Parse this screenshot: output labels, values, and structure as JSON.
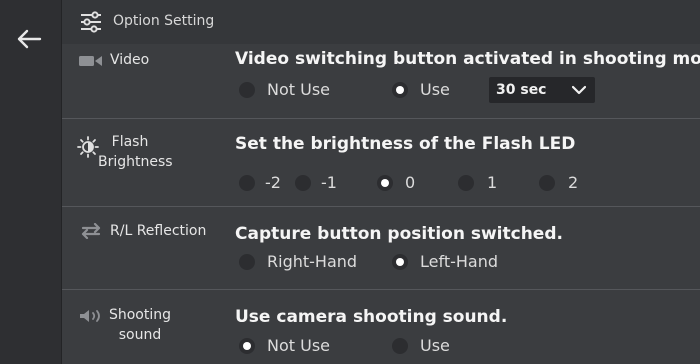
{
  "header": {
    "title": "Option Setting"
  },
  "sections": {
    "video": {
      "label": "Video",
      "description": "Video switching button activated in shooting mode.",
      "options": [
        "Not Use",
        "Use"
      ],
      "selected": "Use",
      "duration": "30 sec"
    },
    "flash": {
      "label_line1": "Flash",
      "label_line2": "Brightness",
      "description": "Set the brightness of the Flash LED",
      "options": [
        "-2",
        "-1",
        "0",
        "1",
        "2"
      ],
      "selected": "0"
    },
    "reflection": {
      "label": "R/L Reflection",
      "description": "Capture button position switched.",
      "options": [
        "Right-Hand",
        "Left-Hand"
      ],
      "selected": "Left-Hand"
    },
    "sound": {
      "label_line1": "Shooting",
      "label_line2": "sound",
      "description": "Use camera shooting sound.",
      "options": [
        "Not Use",
        "Use"
      ],
      "selected": "Not Use"
    }
  },
  "icons": {
    "back": "arrow-left-icon",
    "header": "sliders-icon",
    "video": "video-camera-icon",
    "flash": "brightness-icon",
    "reflection": "swap-arrows-icon",
    "sound": "speaker-icon"
  }
}
